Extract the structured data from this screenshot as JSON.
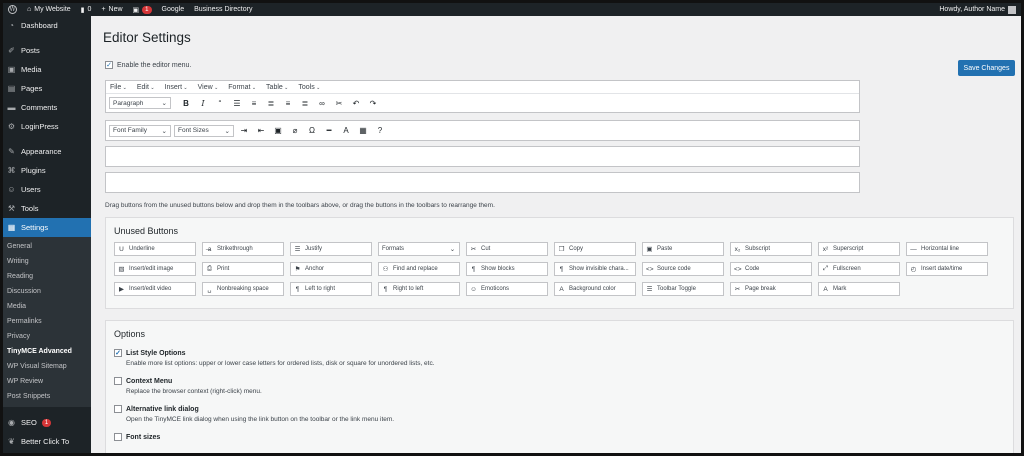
{
  "adminbar": {
    "site_name": "My Website",
    "comments_count": "0",
    "new_label": "New",
    "plugin_badge": "1",
    "links": [
      "Google",
      "Business Directory"
    ],
    "howdy": "Howdy, Author Name"
  },
  "sidebar": {
    "top": [
      {
        "label": "Dashboard",
        "icon": "dashboard-icon",
        "glyph": "◔"
      }
    ],
    "group1": [
      {
        "label": "Posts",
        "icon": "pin-icon",
        "glyph": "✐"
      },
      {
        "label": "Media",
        "icon": "media-icon",
        "glyph": "▣"
      },
      {
        "label": "Pages",
        "icon": "pages-icon",
        "glyph": "▤"
      },
      {
        "label": "Comments",
        "icon": "comments-icon",
        "glyph": "▬"
      },
      {
        "label": "LoginPress",
        "icon": "gear-icon",
        "glyph": "⚙"
      }
    ],
    "group2": [
      {
        "label": "Appearance",
        "icon": "brush-icon",
        "glyph": "✎"
      },
      {
        "label": "Plugins",
        "icon": "plugin-icon",
        "glyph": "⌘"
      },
      {
        "label": "Users",
        "icon": "users-icon",
        "glyph": "☺"
      },
      {
        "label": "Tools",
        "icon": "wrench-icon",
        "glyph": "⚒"
      }
    ],
    "current": {
      "label": "Settings",
      "icon": "settings-icon",
      "glyph": "▦"
    },
    "submenu": [
      "General",
      "Writing",
      "Reading",
      "Discussion",
      "Media",
      "Permalinks",
      "Privacy",
      "TinyMCE Advanced",
      "WP Visual Sitemap",
      "WP Review",
      "Post Snippets"
    ],
    "submenu_bold_index": 7,
    "bottom": [
      {
        "label": "SEO",
        "icon": "seo-icon",
        "glyph": "◉",
        "badge": "1"
      },
      {
        "label": "Better Click To",
        "icon": "bird-icon",
        "glyph": "❦"
      }
    ]
  },
  "page": {
    "title": "Editor Settings",
    "save_label": "Save Changes",
    "enable_menu_label": "Enable the editor menu.",
    "enable_menu_checked": true
  },
  "editor": {
    "menubar": [
      "File",
      "Edit",
      "Insert",
      "View",
      "Format",
      "Table",
      "Tools"
    ],
    "toolbar1_select": "Paragraph",
    "toolbar1_buttons": [
      {
        "name": "bold-icon",
        "glyph": "B"
      },
      {
        "name": "italic-icon",
        "glyph": "I"
      },
      {
        "name": "blockquote-icon",
        "glyph": "“"
      },
      {
        "name": "bullet-list-icon",
        "glyph": "☰"
      },
      {
        "name": "numbered-list-icon",
        "glyph": "≡"
      },
      {
        "name": "align-left-icon",
        "glyph": "≣"
      },
      {
        "name": "align-center-icon",
        "glyph": "≡"
      },
      {
        "name": "align-right-icon",
        "glyph": "≣"
      },
      {
        "name": "link-icon",
        "glyph": "∞"
      },
      {
        "name": "unlink-icon",
        "glyph": "✂"
      },
      {
        "name": "undo-icon",
        "glyph": "↶"
      },
      {
        "name": "redo-icon",
        "glyph": "↷"
      }
    ],
    "toolbar2_selects": [
      "Font Family",
      "Font Sizes"
    ],
    "toolbar2_buttons": [
      {
        "name": "indent-icon",
        "glyph": "⇥"
      },
      {
        "name": "outdent-icon",
        "glyph": "⇤"
      },
      {
        "name": "paste-icon",
        "glyph": "▣"
      },
      {
        "name": "eraser-icon",
        "glyph": "⌀"
      },
      {
        "name": "omega-icon",
        "glyph": "Ω"
      },
      {
        "name": "hr-icon",
        "glyph": "━"
      },
      {
        "name": "text-color-icon",
        "glyph": "A"
      },
      {
        "name": "table-icon",
        "glyph": "▦"
      },
      {
        "name": "help-icon",
        "glyph": "?"
      }
    ]
  },
  "hint_text": "Drag buttons from the unused buttons below and drop them in the toolbars above, or drag the buttons in the toolbars to rearrange them.",
  "unused": {
    "title": "Unused Buttons",
    "buttons": [
      {
        "label": "Underline",
        "icon": "underline-icon",
        "glyph": "U"
      },
      {
        "label": "Strikethrough",
        "icon": "strikethrough-icon",
        "glyph": "̶a"
      },
      {
        "label": "Justify",
        "icon": "justify-icon",
        "glyph": "☰"
      },
      {
        "label": "Formats",
        "icon": "chevron-down-icon",
        "glyph": "⌄",
        "select": true
      },
      {
        "label": "Cut",
        "icon": "cut-icon",
        "glyph": "✂"
      },
      {
        "label": "Copy",
        "icon": "copy-icon",
        "glyph": "❐"
      },
      {
        "label": "Paste",
        "icon": "paste-icon",
        "glyph": "▣"
      },
      {
        "label": "Subscript",
        "icon": "subscript-icon",
        "glyph": "x₂"
      },
      {
        "label": "Superscript",
        "icon": "superscript-icon",
        "glyph": "x²"
      },
      {
        "label": "Horizontal line",
        "icon": "horizontal-line-icon",
        "glyph": "—"
      },
      {
        "label": "Insert/edit image",
        "icon": "image-icon",
        "glyph": "▧"
      },
      {
        "label": "Print",
        "icon": "print-icon",
        "glyph": "⎙"
      },
      {
        "label": "Anchor",
        "icon": "anchor-icon",
        "glyph": "⚑"
      },
      {
        "label": "Find and replace",
        "icon": "binoculars-icon",
        "glyph": "⚇"
      },
      {
        "label": "Show blocks",
        "icon": "show-blocks-icon",
        "glyph": "¶"
      },
      {
        "label": "Show invisible chara...",
        "icon": "pilcrow-icon",
        "glyph": "¶"
      },
      {
        "label": "Source code",
        "icon": "source-code-icon",
        "glyph": "<>"
      },
      {
        "label": "Code",
        "icon": "code-icon",
        "glyph": "<>"
      },
      {
        "label": "Fullscreen",
        "icon": "fullscreen-icon",
        "glyph": "⤢"
      },
      {
        "label": "Insert date/time",
        "icon": "clock-icon",
        "glyph": "◴"
      },
      {
        "label": "Insert/edit video",
        "icon": "video-icon",
        "glyph": "▶"
      },
      {
        "label": "Nonbreaking space",
        "icon": "nonbreaking-space-icon",
        "glyph": "␣"
      },
      {
        "label": "Left to right",
        "icon": "ltr-icon",
        "glyph": "¶"
      },
      {
        "label": "Right to left",
        "icon": "rtl-icon",
        "glyph": "¶"
      },
      {
        "label": "Emoticons",
        "icon": "smiley-icon",
        "glyph": "☺"
      },
      {
        "label": "Background color",
        "icon": "background-color-icon",
        "glyph": "A"
      },
      {
        "label": "Toolbar Toggle",
        "icon": "toolbar-toggle-icon",
        "glyph": "☰"
      },
      {
        "label": "Page break",
        "icon": "page-break-icon",
        "glyph": "✂"
      },
      {
        "label": "Mark",
        "icon": "mark-icon",
        "glyph": "A"
      }
    ]
  },
  "options": {
    "title": "Options",
    "items": [
      {
        "label": "List Style Options",
        "checked": true,
        "desc": "Enable more list options: upper or lower case letters for ordered lists, disk or square for unordered lists, etc."
      },
      {
        "label": "Context Menu",
        "checked": false,
        "desc": "Replace the browser context (right-click) menu."
      },
      {
        "label": "Alternative link dialog",
        "checked": false,
        "desc": "Open the TinyMCE link dialog when using the link button on the toolbar or the link menu item."
      },
      {
        "label": "Font sizes",
        "checked": false,
        "desc": ""
      }
    ]
  }
}
